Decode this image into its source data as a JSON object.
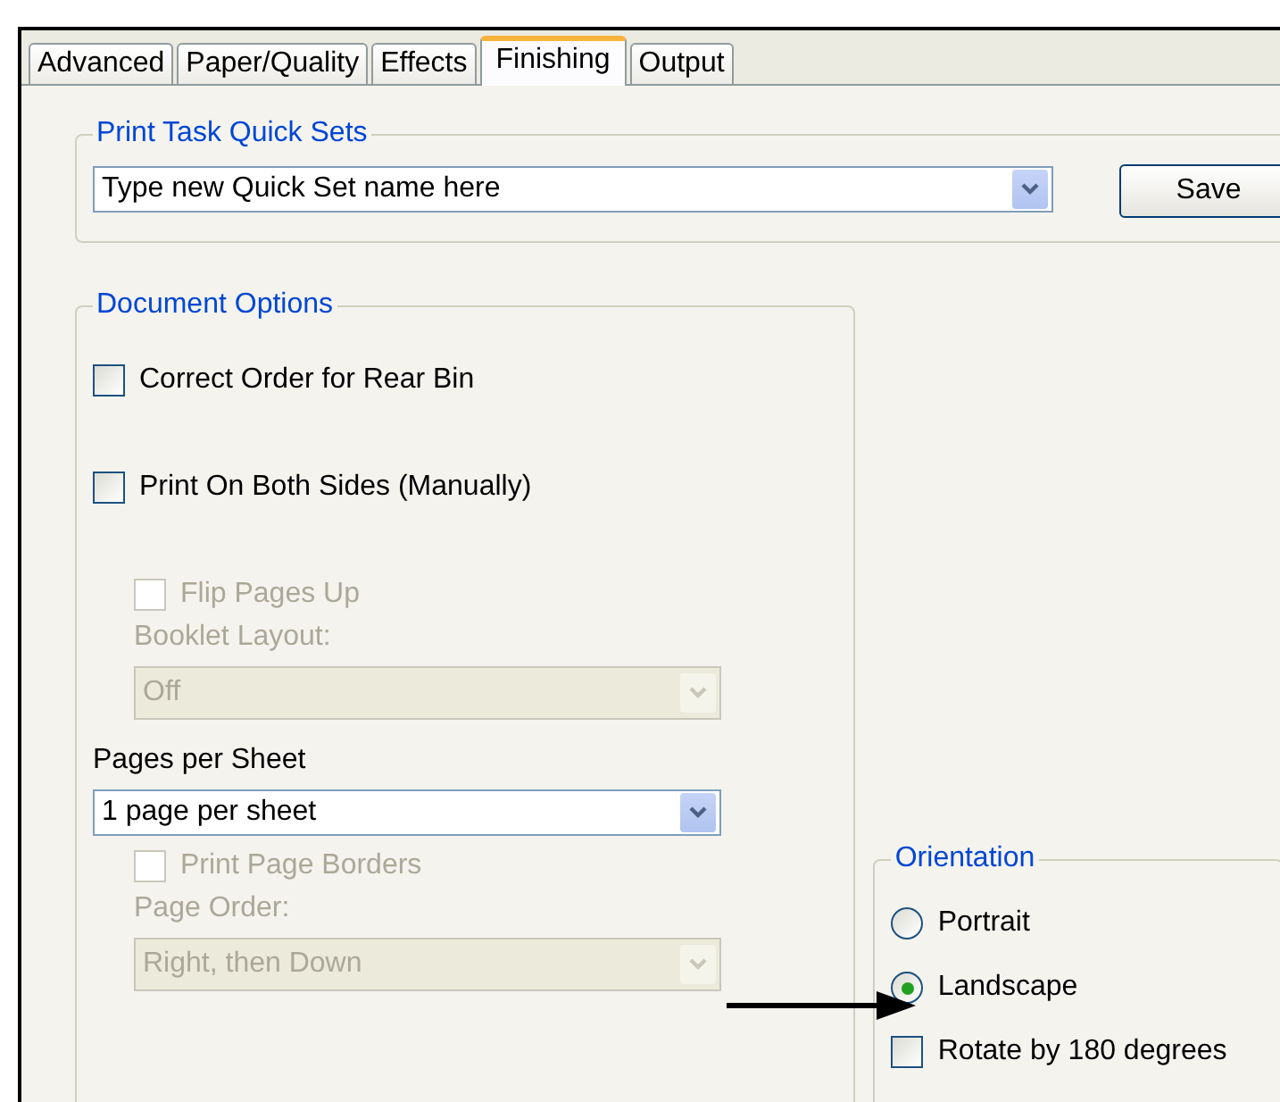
{
  "tabs": [
    {
      "label": "Advanced",
      "selected": false
    },
    {
      "label": "Paper/Quality",
      "selected": false
    },
    {
      "label": "Effects",
      "selected": false
    },
    {
      "label": "Finishing",
      "selected": true
    },
    {
      "label": "Output",
      "selected": false
    }
  ],
  "quick_sets": {
    "title": "Print Task Quick Sets",
    "value": "Type new Quick Set name here",
    "save_button": "Save"
  },
  "document_options": {
    "title": "Document Options",
    "items": [
      {
        "kind": "checkbox",
        "label": "Correct Order for Rear Bin",
        "checked": false,
        "disabled": false
      },
      {
        "kind": "checkbox",
        "label": "Print On Both Sides (Manually)",
        "checked": false,
        "disabled": false,
        "children": [
          {
            "kind": "checkbox",
            "label": "Flip Pages Up",
            "checked": false,
            "disabled": true
          },
          {
            "kind": "label",
            "text": "Booklet Layout:",
            "disabled": true
          },
          {
            "kind": "dropdown",
            "value": "Off",
            "disabled": true
          }
        ]
      },
      {
        "kind": "label",
        "text": "Pages per Sheet",
        "disabled": false
      },
      {
        "kind": "dropdown",
        "value": "1 page per sheet",
        "disabled": false,
        "children": [
          {
            "kind": "checkbox",
            "label": "Print Page Borders",
            "checked": false,
            "disabled": true
          },
          {
            "kind": "label",
            "text": "Page Order:",
            "disabled": true
          },
          {
            "kind": "dropdown",
            "value": "Right, then Down",
            "disabled": true
          }
        ]
      }
    ]
  },
  "orientation": {
    "title": "Orientation",
    "options": [
      {
        "kind": "radio",
        "label": "Portrait",
        "selected": false
      },
      {
        "kind": "radio",
        "label": "Landscape",
        "selected": true
      },
      {
        "kind": "checkbox",
        "label": "Rotate by 180 degrees",
        "checked": false
      }
    ]
  }
}
